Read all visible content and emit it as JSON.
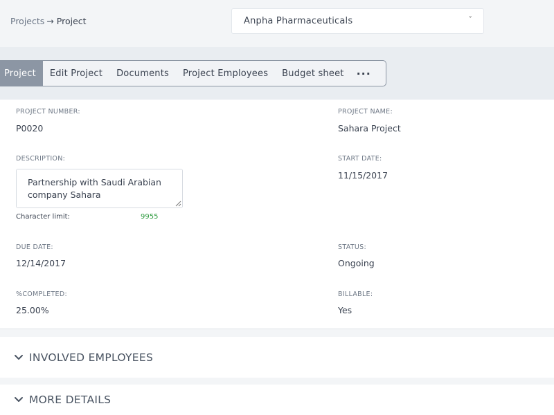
{
  "breadcrumb": {
    "parent": "Projects",
    "arrow": "→",
    "current": "Project"
  },
  "company_select": {
    "value": "Anpha Pharmaceuticals",
    "chevron": "˅"
  },
  "tabs": [
    {
      "label": "Project",
      "active": true
    },
    {
      "label": "Edit Project"
    },
    {
      "label": "Documents"
    },
    {
      "label": "Project Employees"
    },
    {
      "label": "Budget sheet"
    },
    {
      "label": "···"
    }
  ],
  "fields": {
    "project_number": {
      "label": "PROJECT NUMBER:",
      "value": "P0020"
    },
    "project_name": {
      "label": "PROJECT NAME:",
      "value": "Sahara Project"
    },
    "description": {
      "label": "DESCRIPTION:",
      "value": "Partnership with Saudi Arabian company Sahara"
    },
    "start_date": {
      "label": "START DATE:",
      "value": "11/15/2017"
    },
    "character_limit": {
      "label": "Character limit:",
      "value": "9955"
    },
    "due_date": {
      "label": "DUE DATE:",
      "value": "12/14/2017"
    },
    "status": {
      "label": "STATUS:",
      "value": "Ongoing"
    },
    "completed": {
      "label": "%COMPLETED:",
      "value": "25.00%"
    },
    "billable": {
      "label": "BILLABLE:",
      "value": "Yes"
    }
  },
  "sections": {
    "involved_employees": "INVOLVED EMPLOYEES",
    "more_details": "MORE DETAILS"
  },
  "colors": {
    "active_tab": "#8c96a4",
    "char_count": "#2e9b3f"
  }
}
